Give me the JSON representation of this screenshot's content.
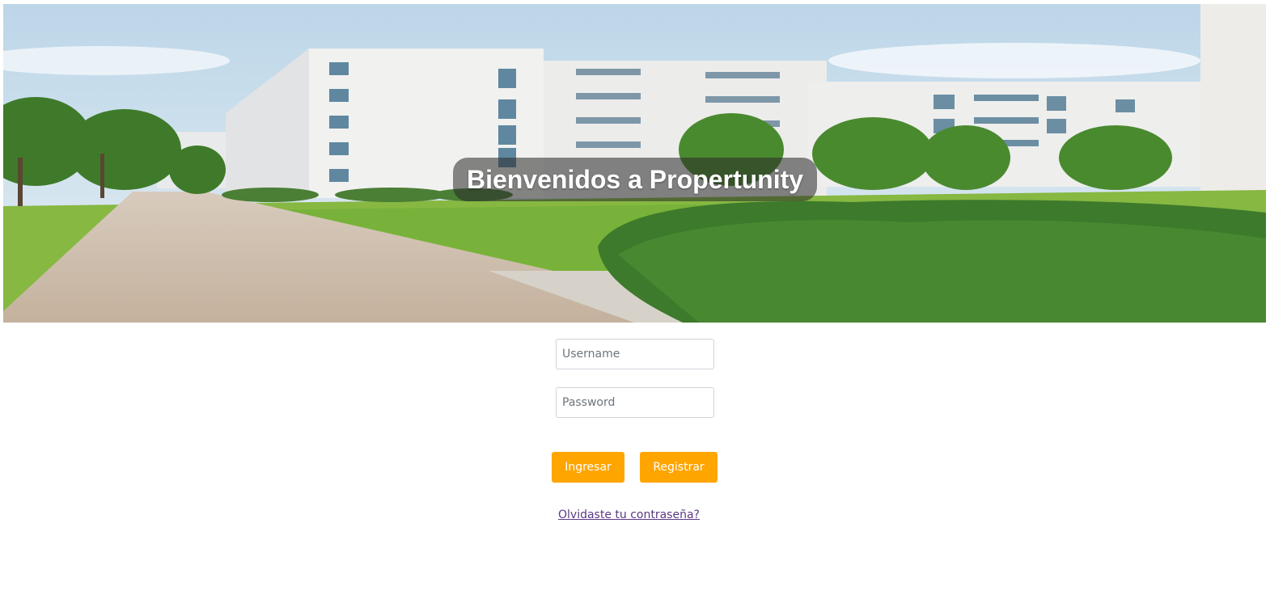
{
  "hero": {
    "title": "Bienvenidos a Propertunity",
    "image": "apartment-buildings-photo"
  },
  "login_form": {
    "username": {
      "value": "",
      "placeholder": "Username"
    },
    "password": {
      "value": "",
      "placeholder": "Password"
    },
    "login_label": "Ingresar",
    "register_label": "Registrar",
    "forgot_label": "Olvidaste tu contraseña?"
  },
  "colors": {
    "accent": "#ffa500",
    "link": "#5a3a84",
    "background": "#ffffff"
  }
}
